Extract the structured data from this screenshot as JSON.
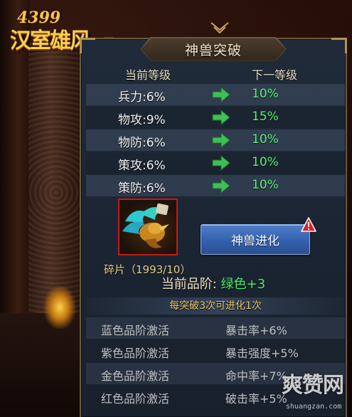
{
  "logo": {
    "number": "4399",
    "name": "汉室雄风"
  },
  "panel": {
    "title": "神兽突破",
    "col_current": "当前等级",
    "col_next": "下一等级",
    "stats": [
      {
        "current": "兵力:6%",
        "next": "10%"
      },
      {
        "current": "物攻:9%",
        "next": "15%"
      },
      {
        "current": "物防:6%",
        "next": "10%"
      },
      {
        "current": "策攻:6%",
        "next": "10%"
      },
      {
        "current": "策防:6%",
        "next": "10%"
      }
    ],
    "fragment": "碎片（1993/10）",
    "evolve_button": "神兽进化",
    "quality_label": "当前品阶:",
    "quality_value": "绿色+3",
    "evolve_note": "每突破3次可进化1次",
    "bonuses": [
      {
        "label": "蓝色品阶激活",
        "value": "暴击率+6%"
      },
      {
        "label": "紫色品阶激活",
        "value": "暴击强度+5%"
      },
      {
        "label": "金色品阶激活",
        "value": "命中率+7%"
      },
      {
        "label": "红色品阶激活",
        "value": "破击率+5%"
      }
    ]
  },
  "watermark": {
    "main": "爽赞网",
    "sub": "shuangzan.com"
  },
  "colors": {
    "accent_green": "#5ef07c",
    "button_blue": "#3461ad",
    "gold_text": "#e6c46a",
    "panel_bg": "#1b2533"
  },
  "icons": {
    "arrow": "right-arrow-icon",
    "alert": "exclamation-alert-icon"
  }
}
